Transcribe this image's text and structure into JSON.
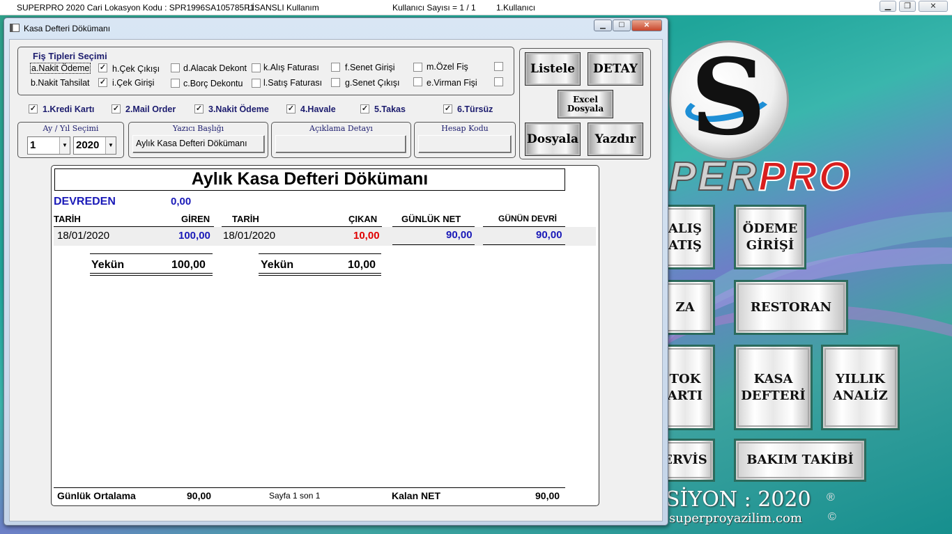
{
  "appbar": {
    "product": "SUPERPRO 2020 Cari Lokasyon Kodu : SPR1996SA105785P1",
    "license": "LİSANSLI Kullanım",
    "users": "Kullanıcı Sayısı = 1 / 1",
    "current_user": "1.Kullanıcı"
  },
  "window": {
    "title": "Kasa Defteri Dökümanı"
  },
  "fis_tipleri": {
    "title": "Fiş Tipleri Seçimi",
    "items": [
      {
        "label": "a.Nakit Ödeme",
        "checked": true
      },
      {
        "label": "h.Çek Çıkışı",
        "checked": false
      },
      {
        "label": "d.Alacak Dekont",
        "checked": false
      },
      {
        "label": "k.Alış Faturası",
        "checked": false
      },
      {
        "label": "f.Senet Girişi",
        "checked": false
      },
      {
        "label": "m.Özel Fiş",
        "checked": false
      },
      {
        "label": "b.Nakit Tahsilat",
        "checked": true
      },
      {
        "label": "i.Çek Girişi",
        "checked": false
      },
      {
        "label": "c.Borç Dekontu",
        "checked": false
      },
      {
        "label": "l.Satış Faturası",
        "checked": false
      },
      {
        "label": "g.Senet Çıkışı",
        "checked": false
      },
      {
        "label": "e.Virman Fişi",
        "checked": false
      }
    ]
  },
  "odeme_tipleri": [
    {
      "label": "1.Kredi Kartı",
      "checked": true
    },
    {
      "label": "2.Mail Order",
      "checked": true
    },
    {
      "label": "3.Nakit Ödeme",
      "checked": true
    },
    {
      "label": "4.Havale",
      "checked": true
    },
    {
      "label": "5.Takas",
      "checked": true
    },
    {
      "label": "6.Türsüz",
      "checked": true
    }
  ],
  "ay_yil": {
    "title": "Ay / Yıl Seçimi",
    "month": "1",
    "year": "2020"
  },
  "yazici_basligi": {
    "title": "Yazıcı Başlığı",
    "value": "Aylık Kasa Defteri Dökümanı"
  },
  "aciklama_detayi": {
    "title": "Açıklama Detayı",
    "value": ""
  },
  "hesap_kodu": {
    "title": "Hesap Kodu",
    "value": ""
  },
  "actions": {
    "listele": "Listele",
    "detay": "DETAY",
    "excel_line1": "Excel",
    "excel_line2": "Dosyala",
    "dosyala": "Dosyala",
    "yazdir": "Yazdır"
  },
  "report": {
    "title": "Aylık Kasa Defteri Dökümanı",
    "devreden_label": "DEVREDEN",
    "devreden_value": "0,00",
    "headers": {
      "tarih_in": "TARİH",
      "giren": "GİREN",
      "tarih_out": "TARİH",
      "cikan": "ÇIKAN",
      "gunluk_net": "GÜNLÜK NET",
      "gunun_devri": "GÜNÜN DEVRİ"
    },
    "rows": [
      {
        "tarih_in": "18/01/2020",
        "giren": "100,00",
        "tarih_out": "18/01/2020",
        "cikan": "10,00",
        "gunluk_net": "90,00",
        "gunun_devri": "90,00"
      }
    ],
    "yekun_label": "Yekün",
    "yekun_giren": "100,00",
    "yekun_cikan": "10,00",
    "footer": {
      "gunluk_ortalama_label": "Günlük Ortalama",
      "gunluk_ortalama_value": "90,00",
      "page": "Sayfa 1 son 1",
      "kalan_net_label": "Kalan NET",
      "kalan_net_value": "90,00"
    }
  },
  "main_menu": {
    "logo_per": "PER",
    "logo_pro": "PRO",
    "buttons": [
      {
        "label": "ALIŞ\nATIŞ"
      },
      {
        "label": "ÖDEME\nGİRİŞİ"
      },
      {
        "label": "ZA"
      },
      {
        "label": "RESTORAN"
      },
      {
        "label": "TOK\nARTI"
      },
      {
        "label": "KASA\nDEFTERİ"
      },
      {
        "label": "YILLIK\nANALİZ"
      },
      {
        "label": "ERVİS"
      },
      {
        "label": "BAKIM TAKİBİ"
      }
    ],
    "version": "SİYON : 2020",
    "website": "superproyazilim.com",
    "reg": "®",
    "copy": "©"
  }
}
